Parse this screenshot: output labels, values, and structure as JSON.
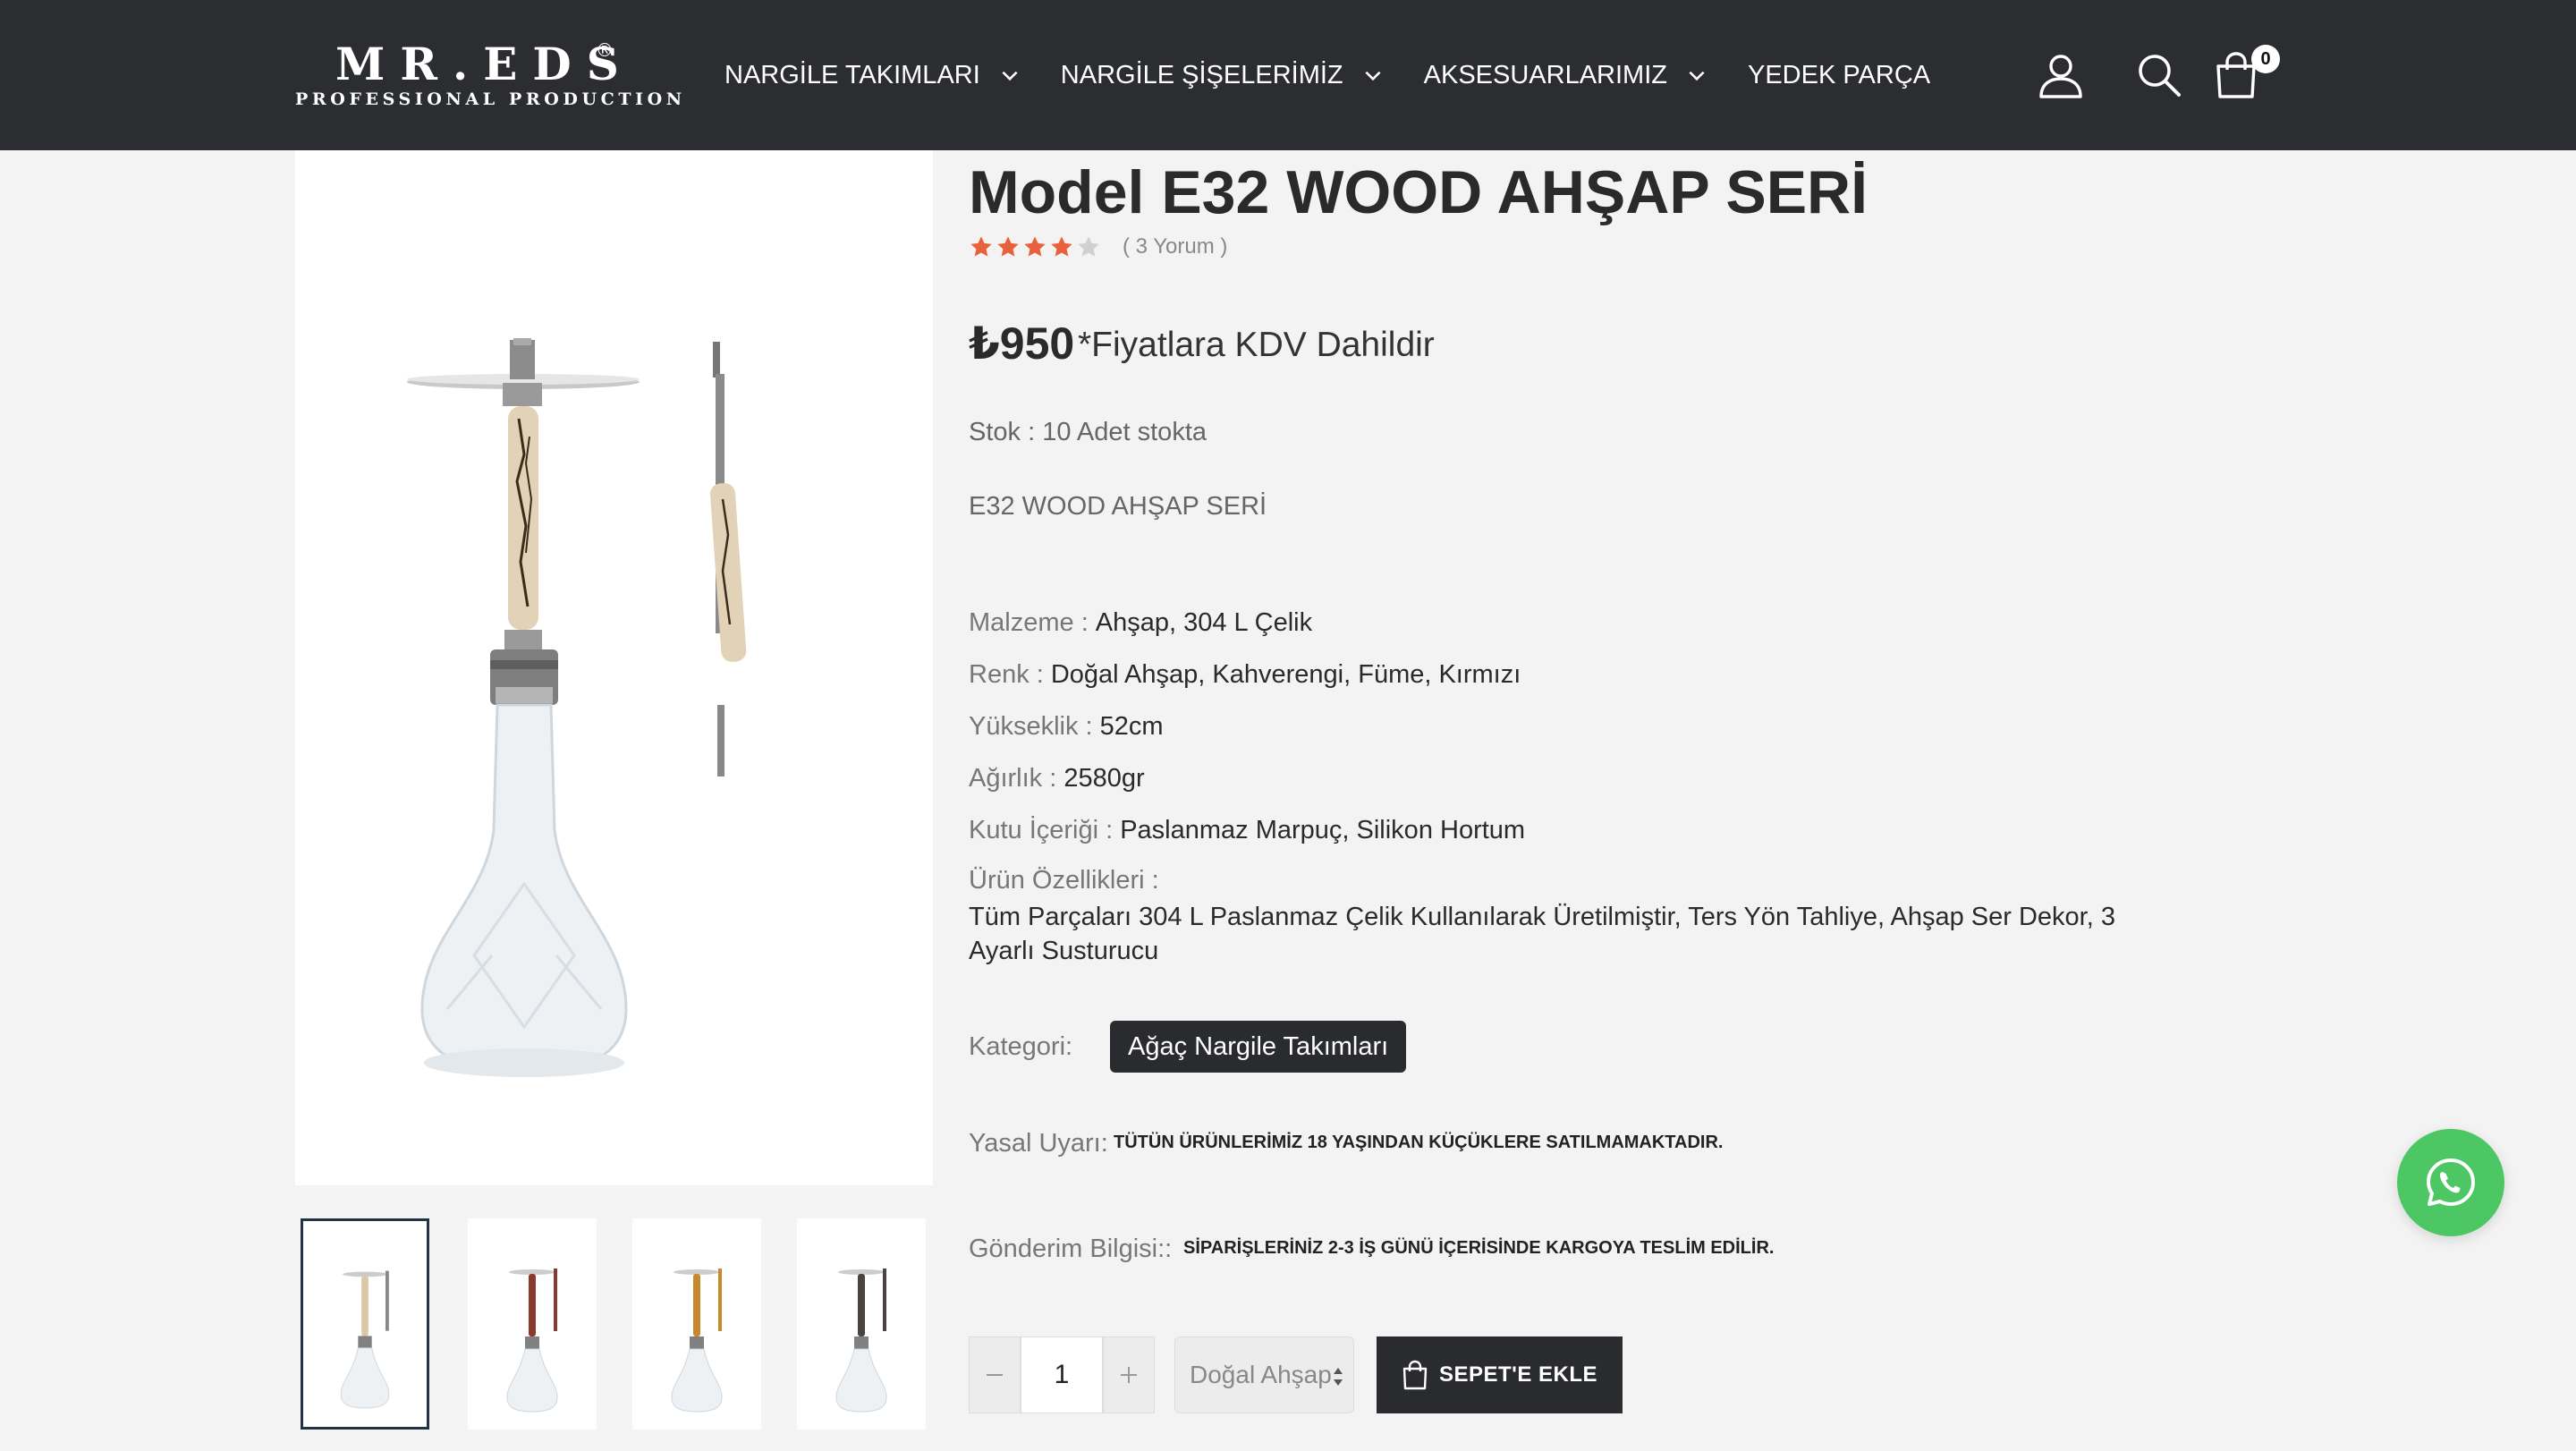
{
  "header": {
    "logo_main": "MR.EDS",
    "logo_reg": "®",
    "logo_sub": "PROFESSIONAL PRODUCTION",
    "nav": [
      {
        "label": "NARGİLE TAKIMLARI",
        "has_dropdown": true
      },
      {
        "label": "NARGİLE ŞİŞELERİMİZ",
        "has_dropdown": true
      },
      {
        "label": "AKSESUARLARIMIZ",
        "has_dropdown": true
      },
      {
        "label": "YEDEK PARÇA",
        "has_dropdown": false
      }
    ],
    "icons": [
      "user-icon",
      "search-icon",
      "cart-icon"
    ],
    "cart_count": "0"
  },
  "gallery": {
    "thumbnail_count": 4,
    "active_thumbnail": 1
  },
  "product": {
    "title": "Model E32 WOOD AHŞAP SERİ",
    "rating": 4,
    "rating_max": 5,
    "review_count": "( 3 Yorum )",
    "price": "₺950",
    "price_note": "*Fiyatlara KDV Dahildir",
    "stock": "Stok : 10 Adet stokta",
    "short_description": "E32 WOOD AHŞAP SERİ",
    "specs": [
      {
        "key": "Malzeme :",
        "value": "Ahşap, 304 L Çelik"
      },
      {
        "key": "Renk :",
        "value": "Doğal Ahşap, Kahverengi, Füme, Kırmızı"
      },
      {
        "key": "Yükseklik :",
        "value": "52cm"
      },
      {
        "key": "Ağırlık :",
        "value": "2580gr"
      },
      {
        "key": "Kutu İçeriği :",
        "value": "Paslanmaz Marpuç, Silikon Hortum"
      }
    ],
    "features_key": "Ürün Özellikleri :",
    "features_value": "Tüm Parçaları 304 L Paslanmaz Çelik Kullanılarak Üretilmiştir, Ters Yön Tahliye, Ahşap Ser Dekor, 3 Ayarlı Susturucu",
    "category_label": "Kategori:",
    "category": "Ağaç Nargile Takımları",
    "legal_label": "Yasal Uyarı:",
    "legal_text": "TÜTÜN ÜRÜNLERİMİZ 18 YAŞINDAN KÜÇÜKLERE SATILMAMAKTADIR.",
    "shipping_label": "Gönderim Bilgisi::",
    "shipping_text": "SİPARİŞLERİNİZ 2-3 İŞ GÜNÜ İÇERİSİNDE KARGOYA TESLİM EDİLİR."
  },
  "purchase": {
    "quantity": "1",
    "variant_selected": "Doğal Ahşap",
    "add_to_cart_label": "SEPET'E EKLE"
  },
  "colors": {
    "header_bg": "#2c2d30",
    "star": "#e8603c",
    "whatsapp": "#4cc764",
    "button_dark": "#2a2b2e"
  }
}
